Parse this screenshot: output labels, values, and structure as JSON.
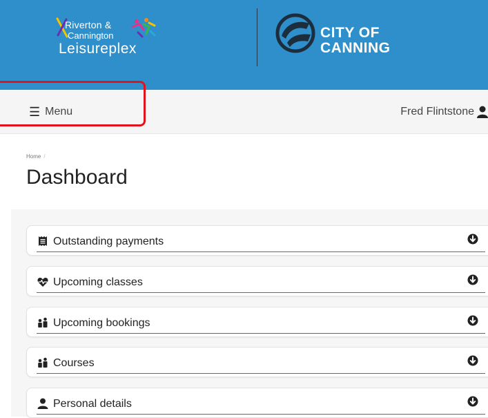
{
  "header": {
    "leisure_logo": {
      "line1": "Riverton &",
      "line2": "Cannington",
      "line3": "Leisureplex"
    },
    "council_logo": {
      "line1": "CITY OF",
      "line2": "CANNING"
    },
    "brand_color": "#2f8fcb"
  },
  "topbar": {
    "menu_label": "Menu",
    "user_name": "Fred Flintstone"
  },
  "page": {
    "breadcrumb_home": "Home",
    "title": "Dashboard"
  },
  "sections": [
    {
      "label": "Outstanding payments",
      "icon": "receipt-icon"
    },
    {
      "label": "Upcoming classes",
      "icon": "heartbeat-icon"
    },
    {
      "label": "Upcoming bookings",
      "icon": "people-icon"
    },
    {
      "label": "Courses",
      "icon": "people-icon"
    },
    {
      "label": "Personal details",
      "icon": "user-icon"
    }
  ]
}
